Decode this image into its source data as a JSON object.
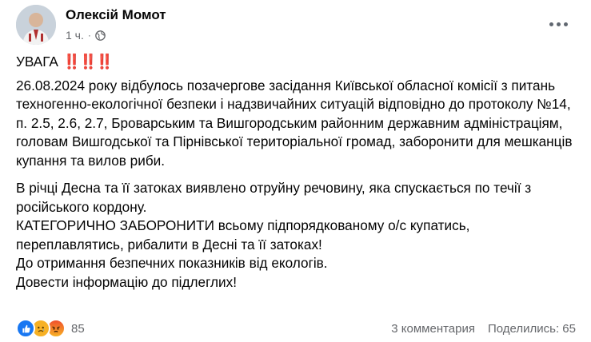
{
  "post": {
    "author": "Олексій Момот",
    "time": "1 ч.",
    "headline": "УВАГА",
    "headline_marks": "‼️‼️‼️",
    "paragraph1": "26.08.2024 року відбулось позачергове засідання Київської обласної комісії з питань техногенно-екологічної безпеки і надзвичайних ситуацій відповідно до протоколу №14, п. 2.5, 2.6, 2.7, Броварським та Вишгородським районним державним адміністраціям, головам Вишгодської та Пірнівської територіальної громад, заборонити для мешканців купання та вилов риби.",
    "lines": [
      "В річці Десна та її затоках виявлено отруйну речовину, яка спускається по течії з російського кордону.",
      "КАТЕГОРИЧНО ЗАБОРОНИТИ всьому підпорядкованому о/с купатись, переплавлятись, рибалити в Десні та її затоках!",
      "До отримання безпечних показників від екологів.",
      "Довести інформацію до підлеглих!"
    ]
  },
  "footer": {
    "reaction_count": "85",
    "reactions": [
      "like-icon",
      "sad-icon",
      "angry-icon"
    ],
    "comments": "3 комментария",
    "shares": "Поделились: 65"
  },
  "colors": {
    "reaction_like": "#1877f2",
    "reaction_sad": "#f7b125",
    "reaction_angry": "#f0502d",
    "secondary_text": "#65676b",
    "alert_red": "#e41e3f"
  }
}
